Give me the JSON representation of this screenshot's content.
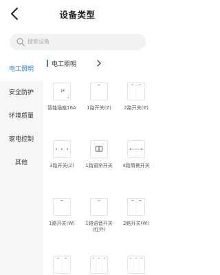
{
  "header": {
    "title": "设备类型",
    "back_icon": "back-arrow-icon"
  },
  "search": {
    "placeholder": "搜索设备",
    "icon": "search-icon"
  },
  "sidebar": {
    "active_color": "#2a7ad6",
    "items": [
      {
        "label": "电工照明",
        "active": true
      },
      {
        "label": "安全防护",
        "active": false
      },
      {
        "label": "环境质量",
        "active": false
      },
      {
        "label": "家电控制",
        "active": false
      },
      {
        "label": "其他",
        "active": false
      }
    ]
  },
  "category": {
    "name": "电工照明",
    "arrow": "chevron-right-icon"
  },
  "devices": [
    {
      "label": "智能插座16A",
      "icon": "socket-device-icon"
    },
    {
      "label": "1路开关(Z)",
      "icon": "switch-1-gang-icon"
    },
    {
      "label": "2路开关(Z)",
      "icon": "switch-2-gang-icon"
    },
    {
      "label": "3路开关(Z)",
      "icon": "switch-3-gang-icon"
    },
    {
      "label": "1路窗帘开关",
      "icon": "curtain-switch-icon"
    },
    {
      "label": "4路情景开关",
      "icon": "scene-switch-4-icon"
    },
    {
      "label": "1路开关(W)",
      "icon": "switch-1-gang-icon"
    },
    {
      "label": "1路语音开关\n(红外)",
      "icon": "voice-switch-icon"
    },
    {
      "label": "2路开关(W)",
      "icon": "switch-2-gang-icon"
    },
    {
      "label": "",
      "icon": "switch-2-gang-icon"
    },
    {
      "label": "",
      "icon": "switch-3-gang-icon"
    },
    {
      "label": "",
      "icon": "switch-3-gang-icon"
    }
  ]
}
